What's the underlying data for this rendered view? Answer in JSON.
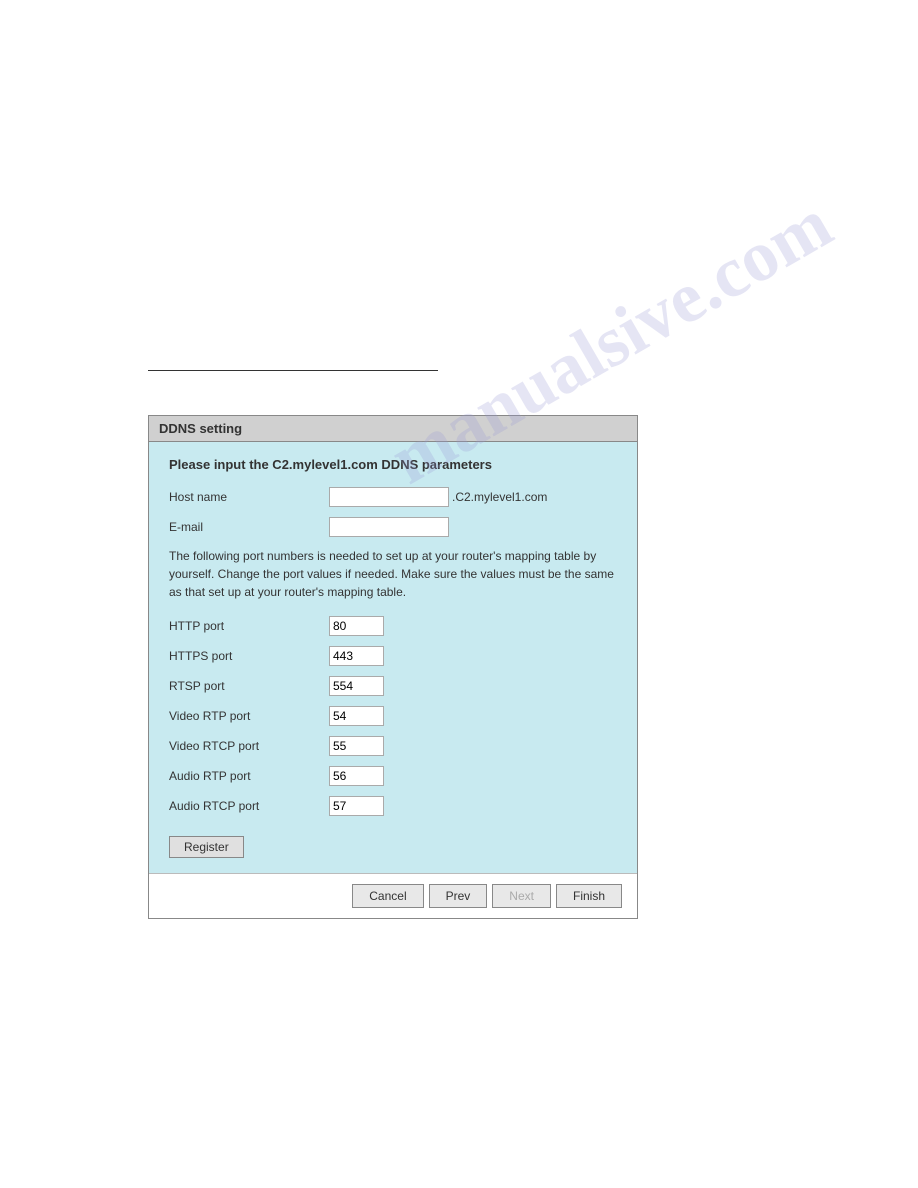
{
  "watermark": {
    "text": "manualsive.com"
  },
  "dialog": {
    "title": "DDNS setting",
    "header": "Please input the C2.mylevel1.com DDNS parameters",
    "fields": {
      "host_name_label": "Host name",
      "host_name_value": "",
      "host_name_suffix": ".C2.mylevel1.com",
      "email_label": "E-mail",
      "email_value": ""
    },
    "description": "The following port numbers is needed to set up at your router's mapping table by yourself. Change the port values if needed. Make sure the values must be the same as that set up at your router's mapping table.",
    "ports": [
      {
        "label": "HTTP port",
        "value": "80"
      },
      {
        "label": "HTTPS port",
        "value": "443"
      },
      {
        "label": "RTSP port",
        "value": "554"
      },
      {
        "label": "Video RTP port",
        "value": "54"
      },
      {
        "label": "Video RTCP port",
        "value": "55"
      },
      {
        "label": "Audio RTP port",
        "value": "56"
      },
      {
        "label": "Audio RTCP port",
        "value": "57"
      }
    ],
    "register_button": "Register",
    "footer": {
      "cancel": "Cancel",
      "prev": "Prev",
      "next": "Next",
      "finish": "Finish"
    }
  }
}
